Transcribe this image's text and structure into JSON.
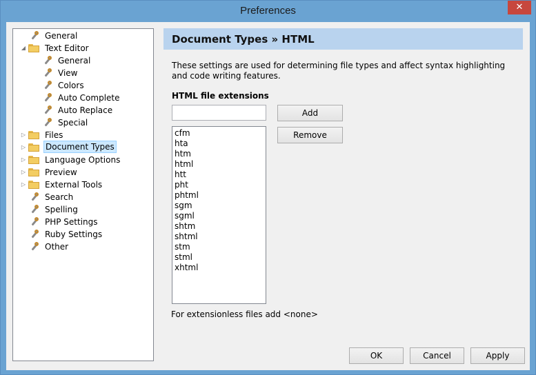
{
  "window": {
    "title": "Preferences",
    "close_glyph": "✕"
  },
  "tree": {
    "items": [
      {
        "label": "General",
        "icon": "wrench-icon",
        "level": 0,
        "expander": ""
      },
      {
        "label": "Text Editor",
        "icon": "folder-icon",
        "level": 0,
        "expander": "◢"
      },
      {
        "label": "General",
        "icon": "wrench-icon",
        "level": 1,
        "expander": ""
      },
      {
        "label": "View",
        "icon": "wrench-icon",
        "level": 1,
        "expander": ""
      },
      {
        "label": "Colors",
        "icon": "wrench-icon",
        "level": 1,
        "expander": ""
      },
      {
        "label": "Auto Complete",
        "icon": "wrench-icon",
        "level": 1,
        "expander": ""
      },
      {
        "label": "Auto Replace",
        "icon": "wrench-icon",
        "level": 1,
        "expander": ""
      },
      {
        "label": "Special",
        "icon": "wrench-icon",
        "level": 1,
        "expander": ""
      },
      {
        "label": "Files",
        "icon": "folder-icon",
        "level": 0,
        "expander": "▷"
      },
      {
        "label": "Document Types",
        "icon": "folder-icon",
        "level": 0,
        "expander": "▷",
        "selected": true
      },
      {
        "label": "Language Options",
        "icon": "folder-icon",
        "level": 0,
        "expander": "▷"
      },
      {
        "label": "Preview",
        "icon": "folder-icon",
        "level": 0,
        "expander": "▷"
      },
      {
        "label": "External Tools",
        "icon": "folder-icon",
        "level": 0,
        "expander": "▷"
      },
      {
        "label": "Search",
        "icon": "wrench-icon",
        "level": 0,
        "expander": ""
      },
      {
        "label": "Spelling",
        "icon": "wrench-icon",
        "level": 0,
        "expander": ""
      },
      {
        "label": "PHP Settings",
        "icon": "wrench-icon",
        "level": 0,
        "expander": ""
      },
      {
        "label": "Ruby Settings",
        "icon": "wrench-icon",
        "level": 0,
        "expander": ""
      },
      {
        "label": "Other",
        "icon": "wrench-icon",
        "level": 0,
        "expander": ""
      }
    ]
  },
  "panel": {
    "header": "Document Types » HTML",
    "description": "These settings are used for determining file types and affect syntax highlighting and code writing features.",
    "extensions_label": "HTML file extensions",
    "extension_input_value": "",
    "add_label": "Add",
    "remove_label": "Remove",
    "extensions": [
      "cfm",
      "hta",
      "htm",
      "html",
      "htt",
      "pht",
      "phtml",
      "sgm",
      "sgml",
      "shtm",
      "shtml",
      "stm",
      "stml",
      "xhtml"
    ],
    "hint": "For extensionless files add <none>"
  },
  "footer": {
    "ok_label": "OK",
    "cancel_label": "Cancel",
    "apply_label": "Apply"
  }
}
